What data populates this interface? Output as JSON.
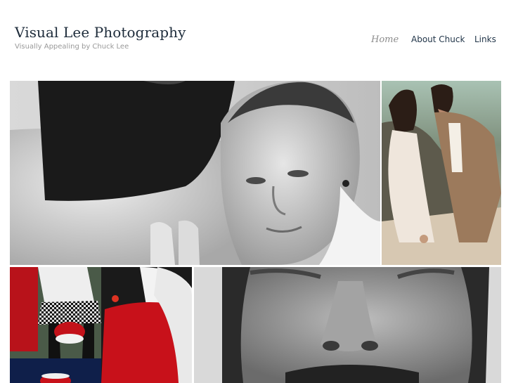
{
  "site": {
    "title": "Visual Lee Photography",
    "tagline": "Visually Appealing by Chuck Lee"
  },
  "nav": {
    "items": [
      {
        "label": "Home",
        "active": true
      },
      {
        "label": "About Chuck",
        "active": false
      },
      {
        "label": "Links",
        "active": false
      }
    ]
  },
  "gallery": {
    "photos": [
      {
        "subject": "black-and-white maternity portrait"
      },
      {
        "subject": "couple kissing on beach"
      },
      {
        "subject": "santa claus holiday photo"
      },
      {
        "subject": "black-and-white close-up face"
      }
    ]
  },
  "colors": {
    "title": "#1d2b3a",
    "nav_text": "#1f3347",
    "nav_active": "#8c8c8c",
    "tagline": "#999999"
  }
}
